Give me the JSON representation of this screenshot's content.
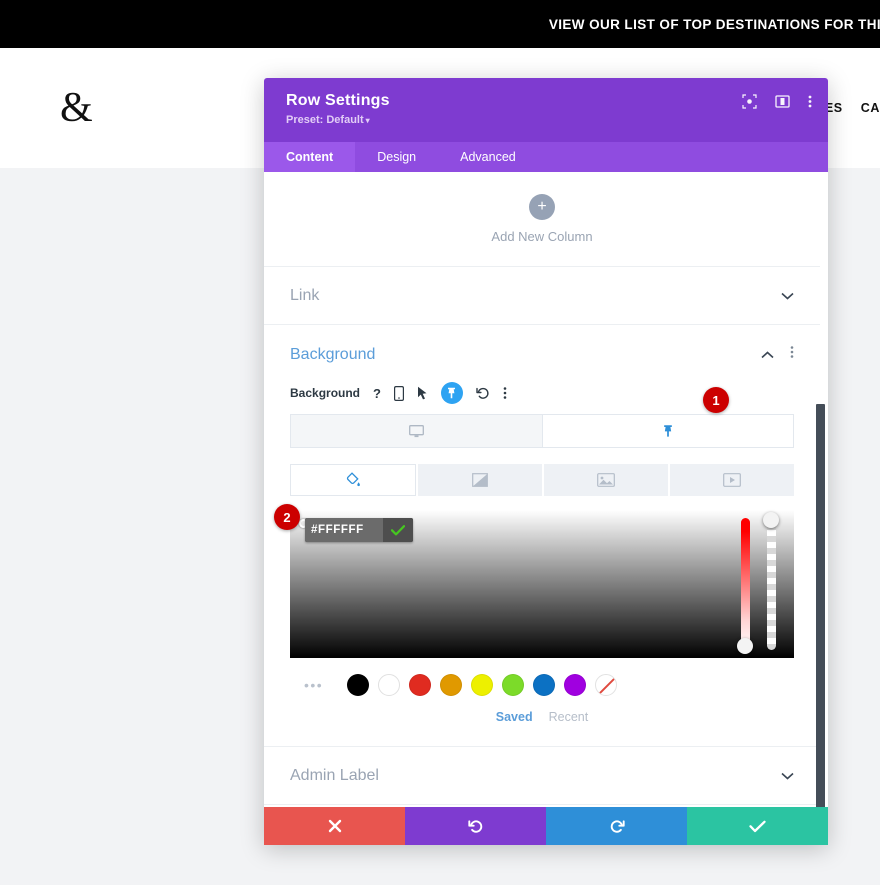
{
  "site": {
    "banner_text": "VIEW OUR LIST OF TOP DESTINATIONS FOR THI",
    "logo": "&",
    "nav": [
      "IES",
      "CA"
    ]
  },
  "modal": {
    "title": "Row Settings",
    "preset_label": "Preset: Default",
    "preset_caret": "▾",
    "header_icons": [
      {
        "name": "focus-icon"
      },
      {
        "name": "split-layout-icon"
      },
      {
        "name": "more-vertical-icon"
      }
    ],
    "tabs": [
      {
        "label": "Content",
        "active": true
      },
      {
        "label": "Design",
        "active": false
      },
      {
        "label": "Advanced",
        "active": false
      }
    ],
    "add_column": {
      "label": "Add New Column",
      "plus": "+"
    },
    "sections": [
      {
        "label": "Link",
        "open": false
      },
      {
        "label": "Admin Label",
        "open": false
      }
    ],
    "background": {
      "title": "Background",
      "field_label": "Background",
      "help_glyph": "?",
      "icons": [
        {
          "name": "help-icon"
        },
        {
          "name": "mobile-icon"
        },
        {
          "name": "cursor-icon"
        },
        {
          "name": "hover-pin-icon"
        },
        {
          "name": "reset-icon"
        },
        {
          "name": "more-vertical-icon"
        }
      ],
      "state_tabs": [
        {
          "name": "desktop-state-tab",
          "active": false
        },
        {
          "name": "hover-state-tab",
          "active": true
        }
      ],
      "type_tabs": [
        {
          "name": "background-color-tab",
          "active": true
        },
        {
          "name": "background-gradient-tab",
          "active": false
        },
        {
          "name": "background-image-tab",
          "active": false
        },
        {
          "name": "background-video-tab",
          "active": false
        }
      ],
      "color_value": "#FFFFFF",
      "color_placeholder": "#FFFFFF",
      "swatches": [
        {
          "name": "swatch-black",
          "hex": "#000000"
        },
        {
          "name": "swatch-white",
          "hex": "#FFFFFF"
        },
        {
          "name": "swatch-red",
          "hex": "#E02B20"
        },
        {
          "name": "swatch-orange",
          "hex": "#E09900"
        },
        {
          "name": "swatch-yellow",
          "hex": "#EDF000"
        },
        {
          "name": "swatch-green",
          "hex": "#7CDB29"
        },
        {
          "name": "swatch-blue",
          "hex": "#0C71C3"
        },
        {
          "name": "swatch-purple",
          "hex": "#A000E0"
        },
        {
          "name": "swatch-none",
          "hex": "transparent"
        }
      ],
      "swatch_more": "•••",
      "palette_tabs": [
        {
          "label": "Saved",
          "active": true
        },
        {
          "label": "Recent",
          "active": false
        }
      ]
    },
    "footer": [
      {
        "name": "cancel-button",
        "glyph": "✖"
      },
      {
        "name": "undo-button",
        "glyph": "↺"
      },
      {
        "name": "redo-button",
        "glyph": "↻"
      },
      {
        "name": "save-button",
        "glyph": "✔"
      }
    ]
  },
  "annotations": [
    {
      "label": "1"
    },
    {
      "label": "2"
    }
  ],
  "colors": {
    "purple_header": "#7E3BD0",
    "purple_tabs": "#8F4CE0",
    "accent_blue": "#2EA3F2",
    "badge_red": "#CC0000"
  }
}
